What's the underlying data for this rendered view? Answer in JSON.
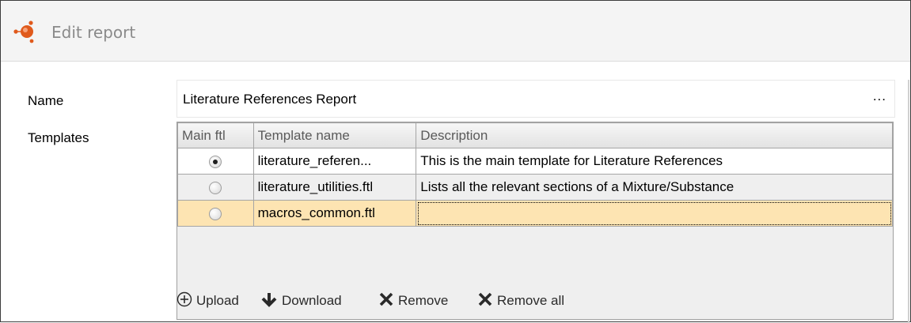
{
  "window": {
    "title": "Edit report"
  },
  "form": {
    "name_label": "Name",
    "name_value": "Literature References Report",
    "name_more": "...",
    "templates_label": "Templates"
  },
  "table": {
    "columns": [
      "Main ftl",
      "Template name",
      "Description"
    ],
    "rows": [
      {
        "main": true,
        "template_name": "literature_referen...",
        "description": "This is the main template for Literature References"
      },
      {
        "main": false,
        "template_name": "literature_utilities.ftl",
        "description": "Lists all the relevant sections of a Mixture/Substance"
      },
      {
        "main": false,
        "template_name": "macros_common.ftl",
        "description": ""
      }
    ]
  },
  "actions": {
    "upload": "Upload",
    "download": "Download",
    "remove": "Remove",
    "remove_all": "Remove all"
  },
  "colors": {
    "selected_row": "#fde4b2",
    "icon_accent": "#e05a1c"
  }
}
